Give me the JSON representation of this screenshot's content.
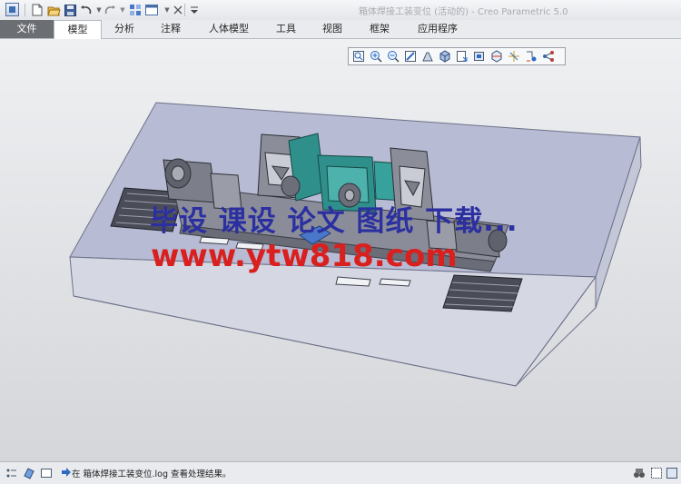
{
  "window": {
    "title": "箱体焊接工装变位 (活动的) - Creo Parametric 5.0"
  },
  "quick_access": [
    {
      "name": "new-icon"
    },
    {
      "name": "open-icon"
    },
    {
      "name": "save-icon"
    },
    {
      "name": "undo-icon"
    },
    {
      "name": "redo-icon"
    },
    {
      "name": "regenerate-icon"
    },
    {
      "name": "window-icon"
    },
    {
      "name": "close-window-icon"
    },
    {
      "name": "customize-icon"
    }
  ],
  "tabs": [
    {
      "label": "文件"
    },
    {
      "label": "模型"
    },
    {
      "label": "分析"
    },
    {
      "label": "注释"
    },
    {
      "label": "人体模型"
    },
    {
      "label": "工具"
    },
    {
      "label": "视图"
    },
    {
      "label": "框架"
    },
    {
      "label": "应用程序"
    }
  ],
  "active_tab": "模型",
  "view_toolbar": [
    {
      "name": "refit-icon"
    },
    {
      "name": "zoom-in-icon"
    },
    {
      "name": "zoom-out-icon"
    },
    {
      "name": "repaint-icon"
    },
    {
      "name": "perspective-icon"
    },
    {
      "name": "display-style-icon"
    },
    {
      "name": "saved-orientations-icon"
    },
    {
      "name": "view-manager-icon"
    },
    {
      "name": "section-icon"
    },
    {
      "name": "datum-display-icon"
    },
    {
      "name": "spin-center-icon"
    },
    {
      "name": "annotation-display-icon"
    }
  ],
  "watermark": {
    "line1": "毕设 课设 论文 图纸 下载...",
    "line2": "www.ytw818.com"
  },
  "status": {
    "message": "在 箱体焊接工装变位.log 查看处理结果。"
  },
  "colors": {
    "accent_blue": "#2b2fa0",
    "watermark_red": "#d9201f",
    "fixture_teal": "#2f8f8b",
    "base_plate": "#b7bbd3"
  }
}
